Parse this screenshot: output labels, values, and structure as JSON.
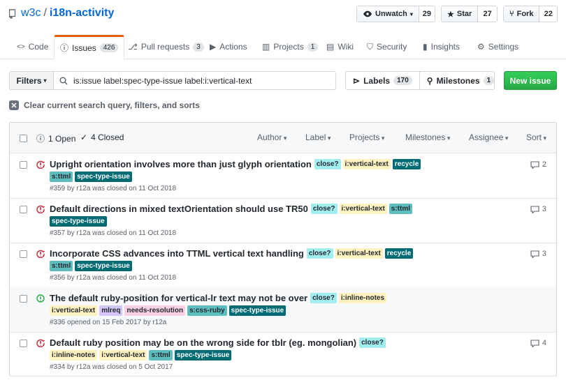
{
  "repo": {
    "owner": "w3c",
    "sep": "/",
    "name": "i18n-activity"
  },
  "header_buttons": {
    "watch": {
      "label": "Unwatch",
      "count": "29"
    },
    "star": {
      "label": "Star",
      "count": "27"
    },
    "fork": {
      "label": "Fork",
      "count": "22"
    }
  },
  "tabs": [
    {
      "label": "Code"
    },
    {
      "label": "Issues",
      "count": "426"
    },
    {
      "label": "Pull requests",
      "count": "3"
    },
    {
      "label": "Actions"
    },
    {
      "label": "Projects",
      "count": "1"
    },
    {
      "label": "Wiki"
    },
    {
      "label": "Security"
    },
    {
      "label": "Insights"
    },
    {
      "label": "Settings"
    }
  ],
  "filter": {
    "button": "Filters",
    "query": "is:issue label:spec-type-issue label:i:vertical-text",
    "labels": "Labels",
    "labels_count": "170",
    "milestones": "Milestones",
    "milestones_count": "1",
    "new_issue": "New issue",
    "clear": "Clear current search query, filters, and sorts"
  },
  "list_header": {
    "open": "1 Open",
    "closed": "4 Closed",
    "author": "Author",
    "label": "Label",
    "projects": "Projects",
    "milestones": "Milestones",
    "assignee": "Assignee",
    "sort": "Sort"
  },
  "colors": {
    "closed": "#cb2431",
    "open": "#28a745",
    "accent": "#e36209"
  },
  "issues": [
    {
      "state": "closed",
      "title": "Upright orientation involves more than just glyph orientation",
      "inline_labels": [
        {
          "text": "close?",
          "bg": "#a2eeef",
          "fg": "#24292e"
        },
        {
          "text": "i:vertical-text",
          "bg": "#fef2c0",
          "fg": "#24292e"
        },
        {
          "text": "recycle",
          "bg": "#006b75",
          "fg": "#ffffff"
        }
      ],
      "labels": [
        {
          "text": "s:ttml",
          "bg": "#5ebdbf",
          "fg": "#24292e"
        },
        {
          "text": "spec-type-issue",
          "bg": "#006b75",
          "fg": "#ffffff"
        }
      ],
      "meta": "#359 by r12a was closed on 11 Oct 2018",
      "comments": "2"
    },
    {
      "state": "closed",
      "title": "Default directions in mixed textOrientation should use TR50",
      "inline_labels": [
        {
          "text": "close?",
          "bg": "#a2eeef",
          "fg": "#24292e"
        },
        {
          "text": "i:vertical-text",
          "bg": "#fef2c0",
          "fg": "#24292e"
        },
        {
          "text": "s:ttml",
          "bg": "#5ebdbf",
          "fg": "#24292e"
        }
      ],
      "labels": [
        {
          "text": "spec-type-issue",
          "bg": "#006b75",
          "fg": "#ffffff"
        }
      ],
      "meta": "#357 by r12a was closed on 11 Oct 2018",
      "comments": "3"
    },
    {
      "state": "closed",
      "title": "Incorporate CSS advances into TTML vertical text handling",
      "inline_labels": [
        {
          "text": "close?",
          "bg": "#a2eeef",
          "fg": "#24292e"
        },
        {
          "text": "i:vertical-text",
          "bg": "#fef2c0",
          "fg": "#24292e"
        },
        {
          "text": "recycle",
          "bg": "#006b75",
          "fg": "#ffffff"
        }
      ],
      "labels": [
        {
          "text": "s:ttml",
          "bg": "#5ebdbf",
          "fg": "#24292e"
        },
        {
          "text": "spec-type-issue",
          "bg": "#006b75",
          "fg": "#ffffff"
        }
      ],
      "meta": "#356 by r12a was closed on 11 Oct 2018",
      "comments": "3"
    },
    {
      "state": "open",
      "title": "The default ruby-position for vertical-lr text may not be over",
      "inline_labels": [
        {
          "text": "close?",
          "bg": "#a2eeef",
          "fg": "#24292e"
        },
        {
          "text": "i:inline-notes",
          "bg": "#fef2c0",
          "fg": "#24292e"
        }
      ],
      "labels": [
        {
          "text": "i:vertical-text",
          "bg": "#fef2c0",
          "fg": "#24292e"
        },
        {
          "text": "mlreq",
          "bg": "#d4c5f9",
          "fg": "#24292e"
        },
        {
          "text": "needs-resolution",
          "bg": "#f9d0e6",
          "fg": "#24292e"
        },
        {
          "text": "s:css-ruby",
          "bg": "#5ebdbf",
          "fg": "#24292e"
        },
        {
          "text": "spec-type-issue",
          "bg": "#006b75",
          "fg": "#ffffff"
        }
      ],
      "meta": "#336 opened on 15 Feb 2017 by r12a",
      "comments": ""
    },
    {
      "state": "closed",
      "title": "Default ruby position may be on the wrong side for tblr (eg. mongolian)",
      "inline_labels": [
        {
          "text": "close?",
          "bg": "#a2eeef",
          "fg": "#24292e"
        }
      ],
      "labels": [
        {
          "text": "i:inline-notes",
          "bg": "#fef2c0",
          "fg": "#24292e"
        },
        {
          "text": "i:vertical-text",
          "bg": "#fef2c0",
          "fg": "#24292e"
        },
        {
          "text": "s:ttml",
          "bg": "#5ebdbf",
          "fg": "#24292e"
        },
        {
          "text": "spec-type-issue",
          "bg": "#006b75",
          "fg": "#ffffff"
        }
      ],
      "meta": "#334 by r12a was closed on 5 Oct 2017",
      "comments": "4"
    }
  ]
}
